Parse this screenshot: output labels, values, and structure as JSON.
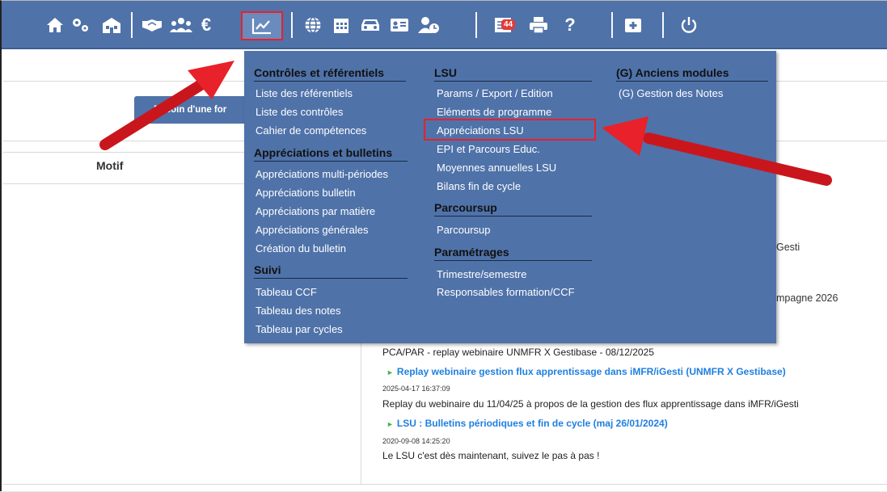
{
  "toolbar": {
    "items": [
      "home-icon",
      "gears-icon",
      "school-building-icon",
      "handshake-icon",
      "people-group-icon",
      "euro-icon",
      "chart-line-icon",
      "globe-icon",
      "calendar-icon",
      "car-icon",
      "id-card-icon",
      "user-clock-icon",
      "message-list-icon",
      "print-icon",
      "help-icon",
      "medical-kit-icon",
      "power-icon"
    ],
    "badge_count": "44",
    "help_label": "?",
    "euro_label": "€"
  },
  "page": {
    "besoin_button": "Besoin d'une for",
    "motif_header": "Motif",
    "side_text_1": "Gesti",
    "side_text_2": "mpagne 2026"
  },
  "menu": {
    "col1": {
      "heading1": "Contrôles et référentiels",
      "items1": [
        "Liste des référentiels",
        "Liste des contrôles",
        "Cahier de compétences"
      ],
      "heading2": "Appréciations et bulletins",
      "items2": [
        "Appréciations multi-périodes",
        "Appréciations bulletin",
        "Appréciations par matière",
        "Appréciations générales",
        "Création du bulletin"
      ],
      "heading3": "Suivi",
      "items3": [
        "Tableau CCF",
        "Tableau des notes",
        "Tableau par cycles"
      ]
    },
    "col2": {
      "heading1": "LSU",
      "items1": [
        "Params / Export / Edition",
        "Eléments de programme",
        "Appréciations LSU",
        "EPI et Parcours Educ.",
        "Moyennes annuelles LSU",
        "Bilans fin de cycle"
      ],
      "heading2": "Parcoursup",
      "items2": [
        "Parcoursup"
      ],
      "heading3": "Paramétrages",
      "items3": [
        "Trimestre/semestre",
        "Responsables formation/CCF"
      ]
    },
    "col3": {
      "heading1": "(G) Anciens modules",
      "items1": [
        "(G) Gestion des Notes"
      ]
    }
  },
  "news": {
    "line0": "PCA/PAR - replay webinaire UNMFR X Gestibase - 08/12/2025",
    "link1": "Replay webinaire gestion flux apprentissage dans iMFR/iGesti (UNMFR X Gestibase)",
    "date1": "2025-04-17 16:37:09",
    "text1": "Replay du webinaire du 11/04/25 à propos de la gestion des flux apprentissage dans iMFR/iGesti",
    "link2": "LSU : Bulletins périodiques et fin de cycle (maj 26/01/2024)",
    "date2": "2020-09-08 14:25:20",
    "text2": "Le LSU c'est dès maintenant, suivez le pas à pas !"
  },
  "colors": {
    "toolbar": "#4f72a9",
    "highlight": "#e8212a",
    "link": "#1f7fe0"
  }
}
